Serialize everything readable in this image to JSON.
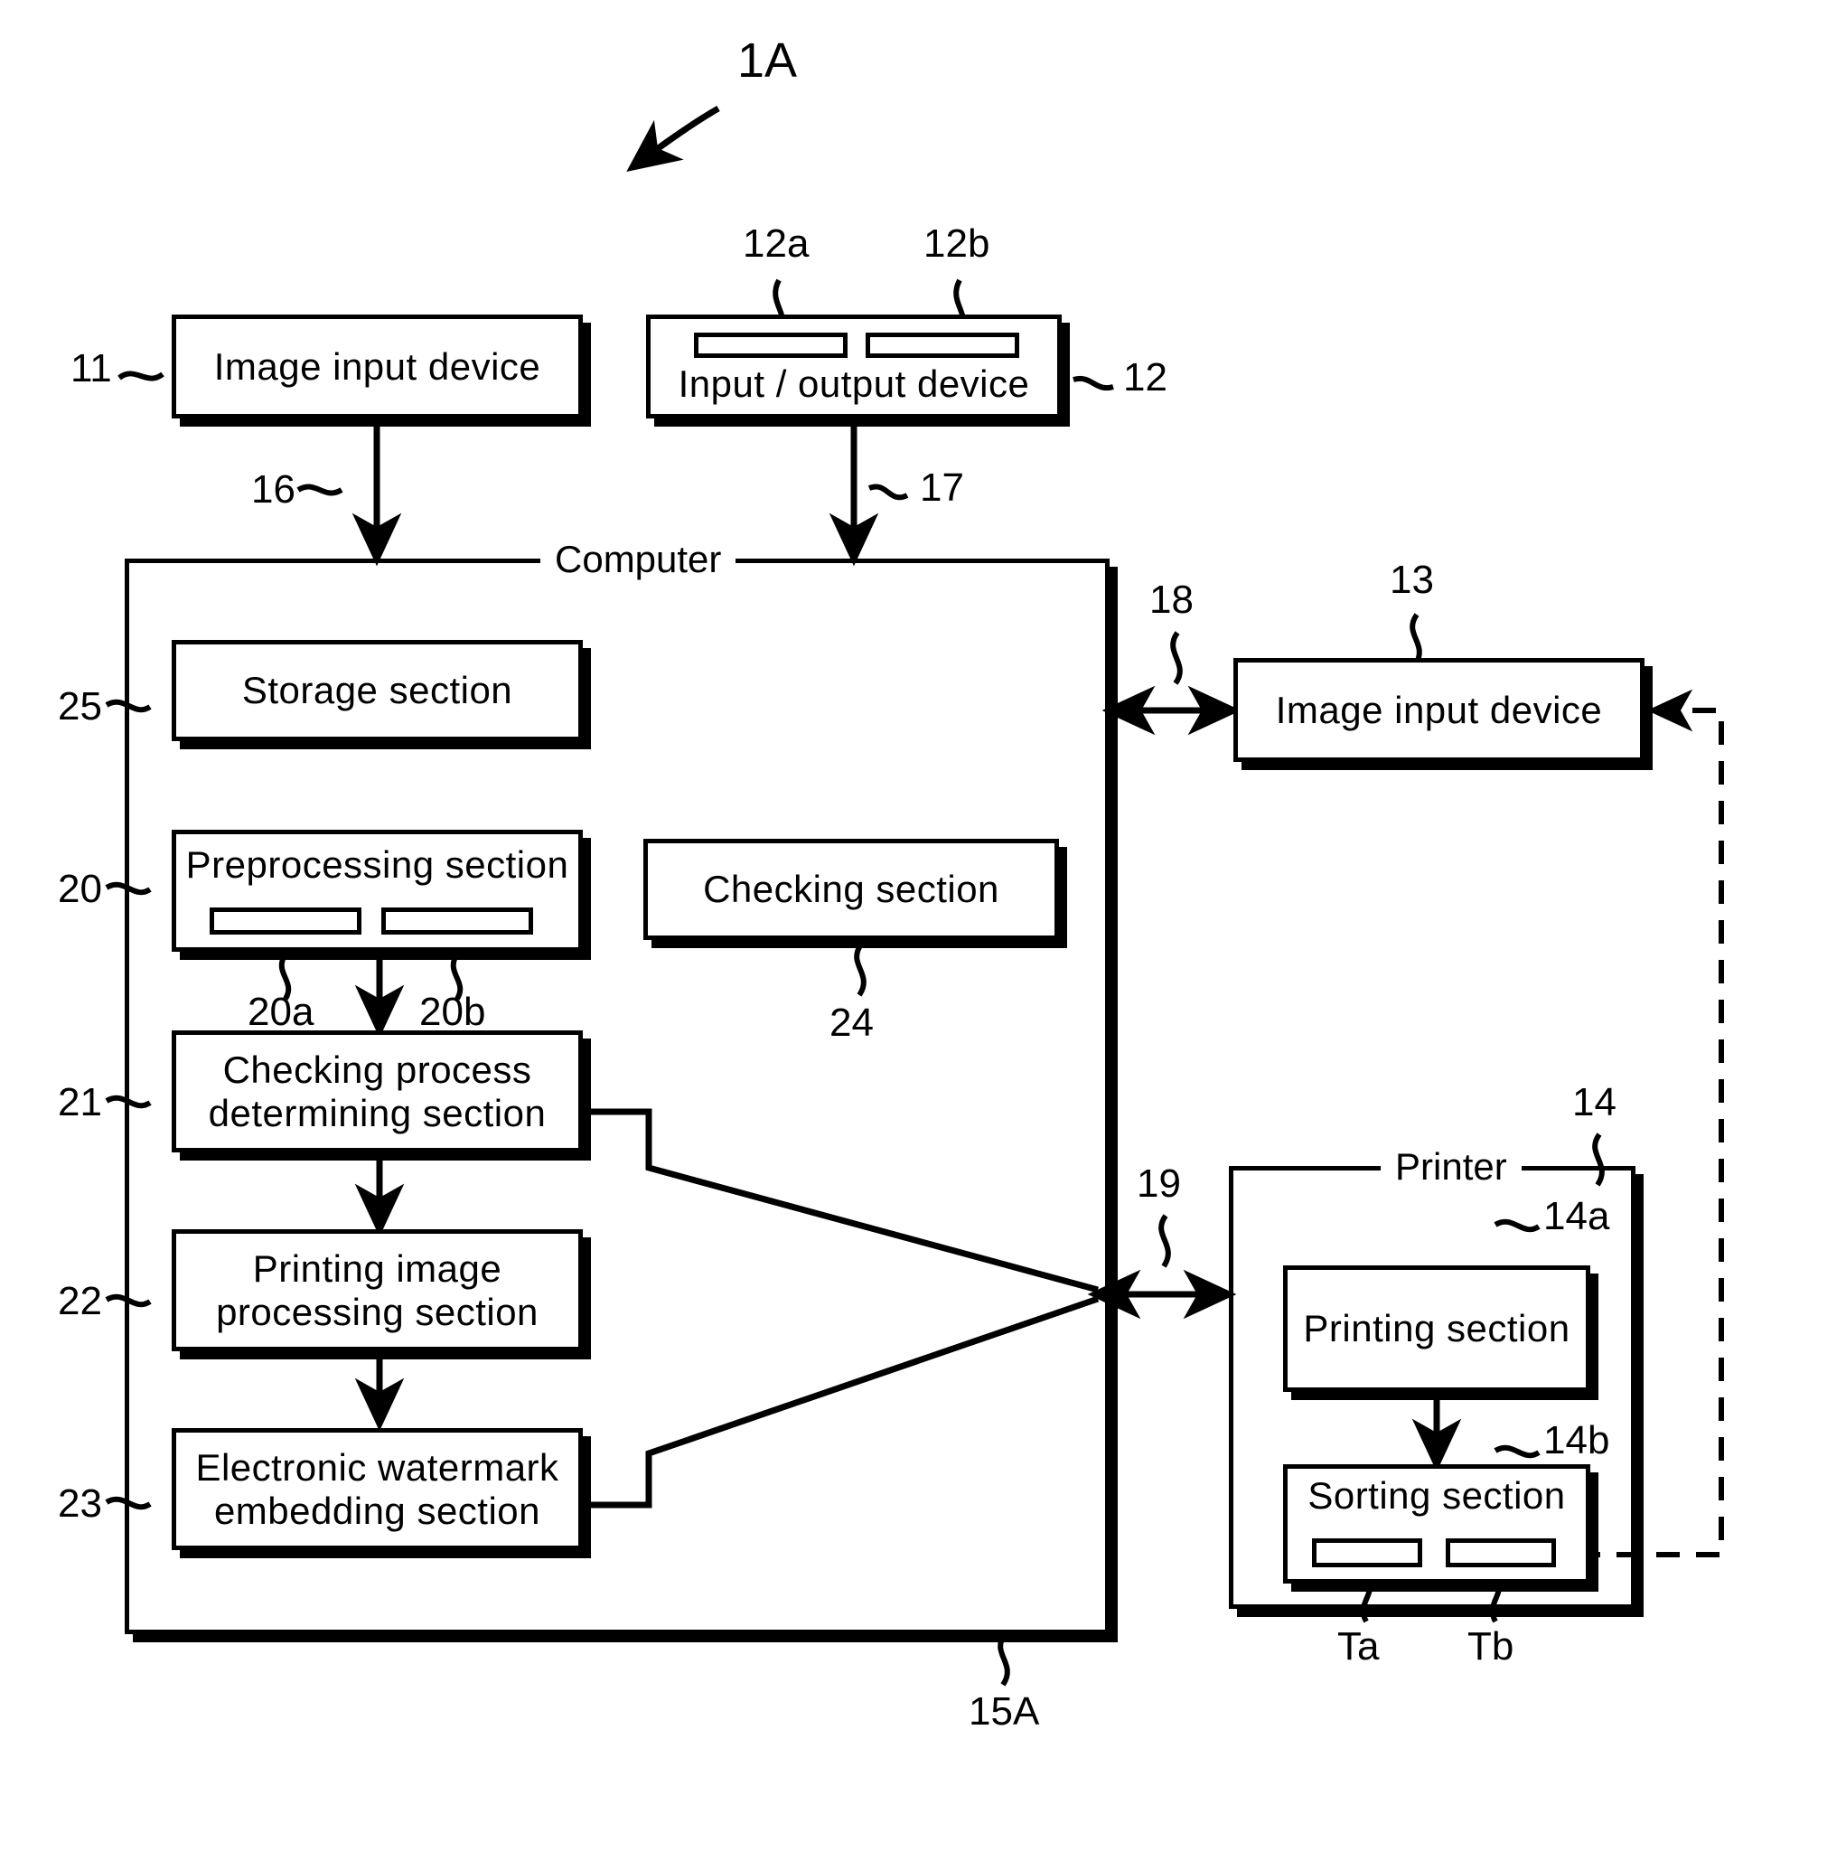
{
  "figure": {
    "id_label": "1A",
    "bottom_label": "15A"
  },
  "blocks": {
    "image_input_device_11": {
      "label": "Image  input  device",
      "ref": "11"
    },
    "input_output_device_12": {
      "label": "Input / output  device",
      "ref": "12",
      "slot_a_ref": "12a",
      "slot_b_ref": "12b"
    },
    "computer": {
      "label": "Computer",
      "ref": "15A"
    },
    "storage_section": {
      "label": "Storage  section",
      "ref": "25"
    },
    "preprocessing_section": {
      "label": "Preprocessing  section",
      "ref": "20",
      "slot_a_ref": "20a",
      "slot_b_ref": "20b"
    },
    "checking_section": {
      "label": "Checking  section",
      "ref": "24"
    },
    "checking_process_determining_section": {
      "line1": "Checking  process",
      "line2": "determining  section",
      "ref": "21"
    },
    "printing_image_processing_section": {
      "line1": "Printing  image",
      "line2": "processing  section",
      "ref": "22"
    },
    "electronic_watermark_embedding_section": {
      "line1": "Electronic  watermark",
      "line2": "embedding  section",
      "ref": "23"
    },
    "image_input_device_13": {
      "label": "Image  input  device",
      "ref": "13"
    },
    "printer": {
      "label": "Printer",
      "ref": "14"
    },
    "printing_section": {
      "label": "Printing  section",
      "ref": "14a"
    },
    "sorting_section": {
      "label": "Sorting  section",
      "ref": "14b",
      "tray_a_ref": "Ta",
      "tray_b_ref": "Tb"
    }
  },
  "connections": {
    "bus_11_to_computer": "16",
    "bus_12_to_computer": "17",
    "bus_computer_to_13": "18",
    "bus_computer_to_printer": "19"
  }
}
